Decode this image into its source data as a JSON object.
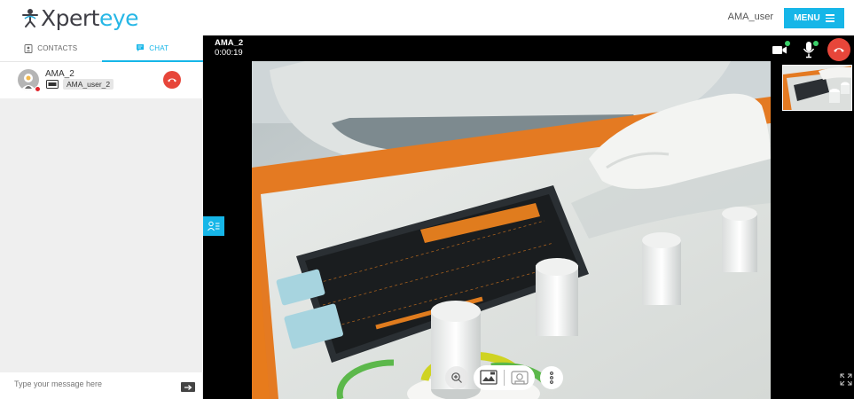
{
  "header": {
    "logo_prefix": "X",
    "logo_middle": "pert",
    "logo_suffix": "eye",
    "user_name": "AMA_user",
    "menu_label": "MENU"
  },
  "tabs": [
    {
      "label": "CONTACTS",
      "icon": "contacts-icon",
      "active": false
    },
    {
      "label": "CHAT",
      "icon": "chat-bubble-icon",
      "active": true
    }
  ],
  "contact": {
    "name": "AMA_2",
    "device_label": "AMA_user_2",
    "status": "busy"
  },
  "chat": {
    "input_placeholder": "Type your message here"
  },
  "call": {
    "caller_name": "AMA_2",
    "duration": "0:00:19"
  },
  "colors": {
    "accent": "#16b6e8",
    "hangup": "#e7463a",
    "status_busy": "#e0242b",
    "indicator_on": "#3bd06a"
  },
  "icons": {
    "video_toggle": "camera-icon",
    "mic_toggle": "microphone-icon",
    "hangup": "phone-hangup-icon",
    "zoom": "zoom-in-icon",
    "snapshot": "image-capture-icon",
    "remote_camera": "camera-switch-icon",
    "more": "more-vertical-icon",
    "fullscreen": "expand-icon",
    "participants": "participants-icon",
    "send": "arrow-right-icon"
  }
}
